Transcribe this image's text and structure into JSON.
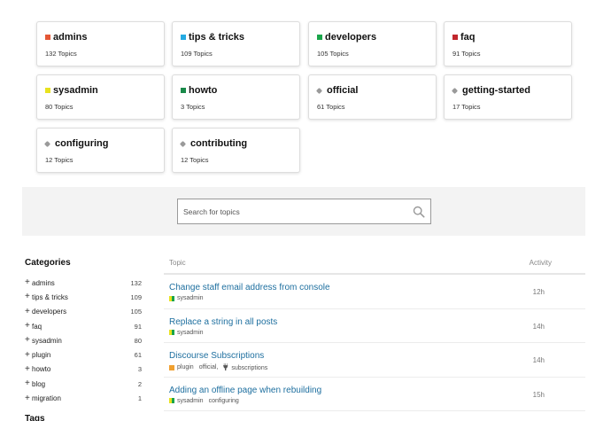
{
  "categories_grid": [
    {
      "name": "admins",
      "count": "132 Topics",
      "icon": "square",
      "color": "#e45735"
    },
    {
      "name": "tips & tricks",
      "count": "109 Topics",
      "icon": "square",
      "color": "#25aae2"
    },
    {
      "name": "developers",
      "count": "105 Topics",
      "icon": "square",
      "color": "#1aa54a"
    },
    {
      "name": "faq",
      "count": "91 Topics",
      "icon": "square",
      "color": "#c1272d"
    },
    {
      "name": "sysadmin",
      "count": "80 Topics",
      "icon": "square",
      "color": "#e8e21f"
    },
    {
      "name": "howto",
      "count": "3 Topics",
      "icon": "square",
      "color": "#1a8a4a"
    },
    {
      "name": "official",
      "count": "61 Topics",
      "icon": "tag-icon",
      "color": "#9a9a9a"
    },
    {
      "name": "getting-started",
      "count": "17 Topics",
      "icon": "tag-icon",
      "color": "#9a9a9a"
    },
    {
      "name": "configuring",
      "count": "12 Topics",
      "icon": "tag-icon",
      "color": "#9a9a9a"
    },
    {
      "name": "contributing",
      "count": "12 Topics",
      "icon": "tag-icon",
      "color": "#9a9a9a"
    }
  ],
  "search": {
    "placeholder": "Search for topics",
    "icon": "search-icon"
  },
  "sidebar": {
    "title": "Categories",
    "items": [
      {
        "name": "admins",
        "count": "132"
      },
      {
        "name": "tips & tricks",
        "count": "109"
      },
      {
        "name": "developers",
        "count": "105"
      },
      {
        "name": "faq",
        "count": "91"
      },
      {
        "name": "sysadmin",
        "count": "80"
      },
      {
        "name": "plugin",
        "count": "61"
      },
      {
        "name": "howto",
        "count": "3"
      },
      {
        "name": "blog",
        "count": "2"
      },
      {
        "name": "migration",
        "count": "1"
      }
    ],
    "tags_title": "Tags"
  },
  "topics": {
    "header": {
      "topic": "Topic",
      "activity": "Activity"
    },
    "rows": [
      {
        "title": "Change staff email address from console",
        "category": "sysadmin",
        "category_colors": [
          "#e8e21f",
          "#1aa54a"
        ],
        "tags": [],
        "activity": "12h"
      },
      {
        "title": "Replace a string in all posts",
        "category": "sysadmin",
        "category_colors": [
          "#e8e21f",
          "#1aa54a"
        ],
        "tags": [],
        "activity": "14h"
      },
      {
        "title": "Discourse Subscriptions",
        "category": "plugin",
        "category_colors": [
          "#f0a030",
          "#f0a030"
        ],
        "tags": [
          "official,",
          "subscriptions"
        ],
        "activity": "14h"
      },
      {
        "title": "Adding an offline page when rebuilding",
        "category": "sysadmin",
        "category_colors": [
          "#e8e21f",
          "#1aa54a"
        ],
        "tags": [
          "configuring"
        ],
        "activity": "15h"
      }
    ]
  }
}
